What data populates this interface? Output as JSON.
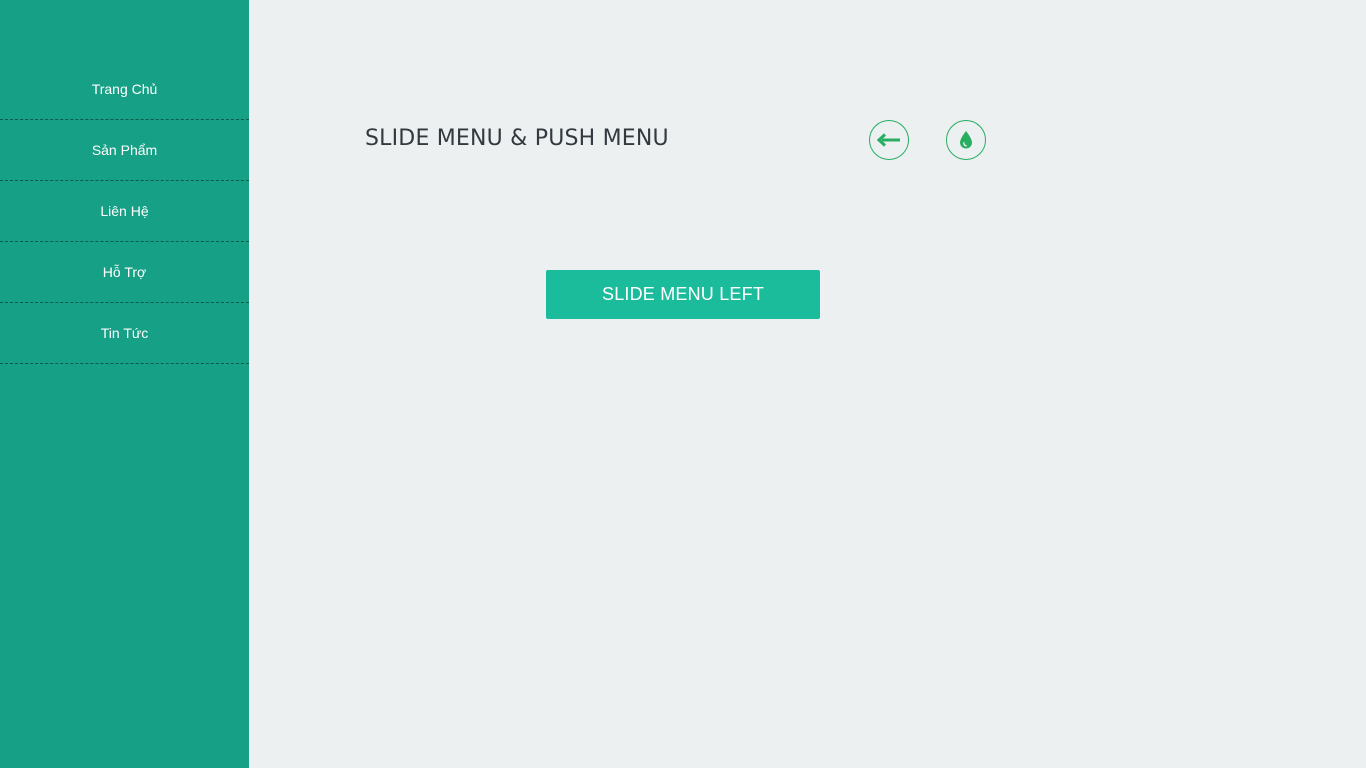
{
  "sidebar": {
    "items": [
      {
        "label": "Trang Chủ"
      },
      {
        "label": "Sản Phẩm"
      },
      {
        "label": "Liên Hệ"
      },
      {
        "label": "Hỗ Trợ"
      },
      {
        "label": "Tin Tức"
      }
    ]
  },
  "header": {
    "title": "SLIDE MENU & PUSH MENU",
    "back_icon": "arrow-left-icon",
    "theme_icon": "droplet-icon"
  },
  "main": {
    "slide_button_label": "SLIDE MENU LEFT"
  },
  "colors": {
    "sidebar_bg": "#16a085",
    "page_bg": "#ecf0f1",
    "button_bg": "#1abc9c",
    "icon_accent": "#27ae60",
    "title_text": "#333a3f"
  }
}
